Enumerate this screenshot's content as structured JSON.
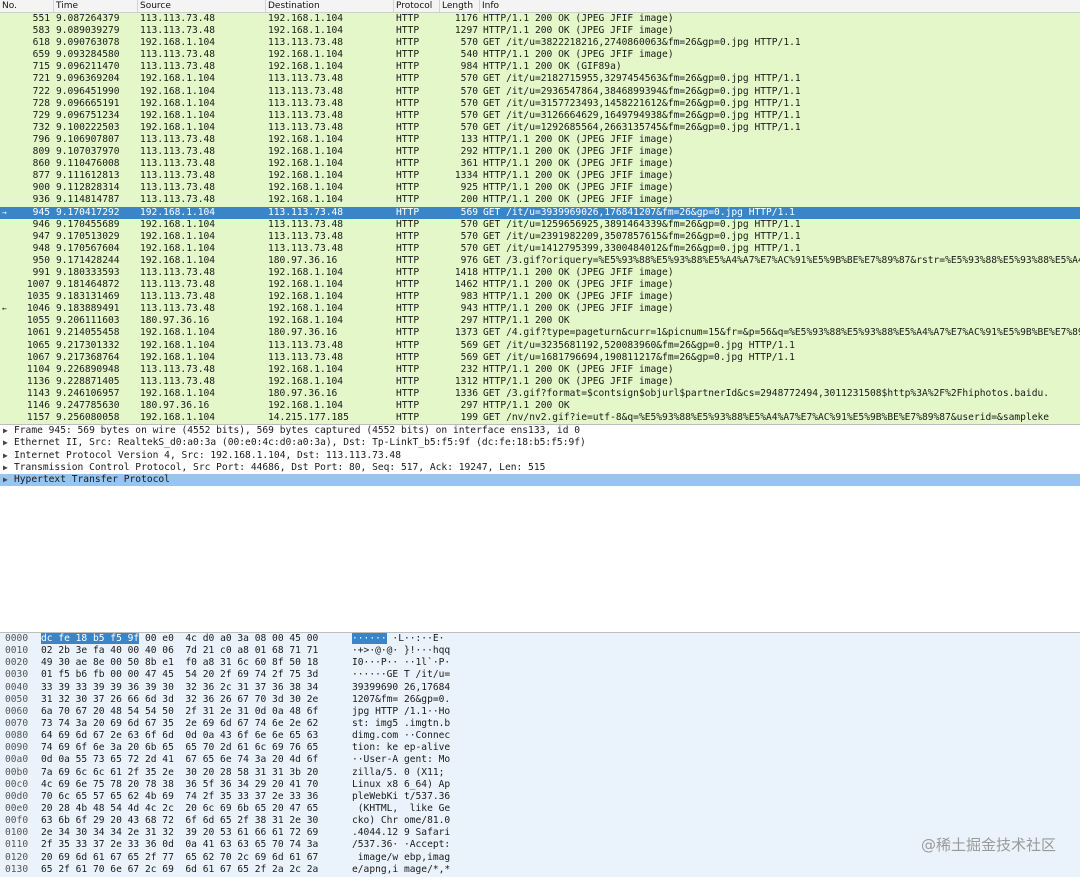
{
  "packet_list": {
    "columns": [
      "No.",
      "Time",
      "Source",
      "Destination",
      "Protocol",
      "Length",
      "Info"
    ],
    "rows": [
      {
        "no": "551",
        "time": "9.087264379",
        "src": "113.113.73.48",
        "dst": "192.168.1.104",
        "proto": "HTTP",
        "len": "1176",
        "info": "HTTP/1.1 200 OK  (JPEG JFIF image)"
      },
      {
        "no": "583",
        "time": "9.089039279",
        "src": "113.113.73.48",
        "dst": "192.168.1.104",
        "proto": "HTTP",
        "len": "1297",
        "info": "HTTP/1.1 200 OK  (JPEG JFIF image)"
      },
      {
        "no": "618",
        "time": "9.090763078",
        "src": "192.168.1.104",
        "dst": "113.113.73.48",
        "proto": "HTTP",
        "len": "570",
        "info": "GET /it/u=3822218216,2740860063&fm=26&gp=0.jpg HTTP/1.1"
      },
      {
        "no": "659",
        "time": "9.093284580",
        "src": "113.113.73.48",
        "dst": "192.168.1.104",
        "proto": "HTTP",
        "len": "540",
        "info": "HTTP/1.1 200 OK  (JPEG JFIF image)"
      },
      {
        "no": "715",
        "time": "9.096211470",
        "src": "113.113.73.48",
        "dst": "192.168.1.104",
        "proto": "HTTP",
        "len": "984",
        "info": "HTTP/1.1 200 OK  (GIF89a)"
      },
      {
        "no": "721",
        "time": "9.096369204",
        "src": "192.168.1.104",
        "dst": "113.113.73.48",
        "proto": "HTTP",
        "len": "570",
        "info": "GET /it/u=2182715955,3297454563&fm=26&gp=0.jpg HTTP/1.1"
      },
      {
        "no": "722",
        "time": "9.096451990",
        "src": "192.168.1.104",
        "dst": "113.113.73.48",
        "proto": "HTTP",
        "len": "570",
        "info": "GET /it/u=2936547864,3846899394&fm=26&gp=0.jpg HTTP/1.1"
      },
      {
        "no": "728",
        "time": "9.096665191",
        "src": "192.168.1.104",
        "dst": "113.113.73.48",
        "proto": "HTTP",
        "len": "570",
        "info": "GET /it/u=3157723493,1458221612&fm=26&gp=0.jpg HTTP/1.1"
      },
      {
        "no": "729",
        "time": "9.096751234",
        "src": "192.168.1.104",
        "dst": "113.113.73.48",
        "proto": "HTTP",
        "len": "570",
        "info": "GET /it/u=3126664629,1649794938&fm=26&gp=0.jpg HTTP/1.1"
      },
      {
        "no": "732",
        "time": "9.100222503",
        "src": "192.168.1.104",
        "dst": "113.113.73.48",
        "proto": "HTTP",
        "len": "570",
        "info": "GET /it/u=1292685564,2663135745&fm=26&gp=0.jpg HTTP/1.1"
      },
      {
        "no": "796",
        "time": "9.106907807",
        "src": "113.113.73.48",
        "dst": "192.168.1.104",
        "proto": "HTTP",
        "len": "133",
        "info": "HTTP/1.1 200 OK  (JPEG JFIF image)"
      },
      {
        "no": "809",
        "time": "9.107037970",
        "src": "113.113.73.48",
        "dst": "192.168.1.104",
        "proto": "HTTP",
        "len": "292",
        "info": "HTTP/1.1 200 OK  (JPEG JFIF image)"
      },
      {
        "no": "860",
        "time": "9.110476008",
        "src": "113.113.73.48",
        "dst": "192.168.1.104",
        "proto": "HTTP",
        "len": "361",
        "info": "HTTP/1.1 200 OK  (JPEG JFIF image)"
      },
      {
        "no": "877",
        "time": "9.111612813",
        "src": "113.113.73.48",
        "dst": "192.168.1.104",
        "proto": "HTTP",
        "len": "1334",
        "info": "HTTP/1.1 200 OK  (JPEG JFIF image)"
      },
      {
        "no": "900",
        "time": "9.112828314",
        "src": "113.113.73.48",
        "dst": "192.168.1.104",
        "proto": "HTTP",
        "len": "925",
        "info": "HTTP/1.1 200 OK  (JPEG JFIF image)"
      },
      {
        "no": "936",
        "time": "9.114814787",
        "src": "113.113.73.48",
        "dst": "192.168.1.104",
        "proto": "HTTP",
        "len": "200",
        "info": "HTTP/1.1 200 OK  (JPEG JFIF image)"
      },
      {
        "no": "945",
        "time": "9.170417292",
        "src": "192.168.1.104",
        "dst": "113.113.73.48",
        "proto": "HTTP",
        "len": "569",
        "info": "GET /it/u=3939969026,176841207&fm=26&gp=0.jpg HTTP/1.1",
        "selected": true,
        "marker": "→"
      },
      {
        "no": "946",
        "time": "9.170455689",
        "src": "192.168.1.104",
        "dst": "113.113.73.48",
        "proto": "HTTP",
        "len": "570",
        "info": "GET /it/u=1259656925,3891464339&fm=26&gp=0.jpg HTTP/1.1"
      },
      {
        "no": "947",
        "time": "9.170513029",
        "src": "192.168.1.104",
        "dst": "113.113.73.48",
        "proto": "HTTP",
        "len": "570",
        "info": "GET /it/u=2391982209,3507857615&fm=26&gp=0.jpg HTTP/1.1"
      },
      {
        "no": "948",
        "time": "9.170567604",
        "src": "192.168.1.104",
        "dst": "113.113.73.48",
        "proto": "HTTP",
        "len": "570",
        "info": "GET /it/u=1412795399,3300484012&fm=26&gp=0.jpg HTTP/1.1"
      },
      {
        "no": "950",
        "time": "9.171428244",
        "src": "192.168.1.104",
        "dst": "180.97.36.16",
        "proto": "HTTP",
        "len": "976",
        "info": "GET /3.gif?oriquery=%E5%93%88%E5%93%88%E5%A4%A7%E7%AC%91%E5%9B%BE%E7%89%87&rstr=%E5%93%88%E5%93%88%E5%A4%A7"
      },
      {
        "no": "991",
        "time": "9.180333593",
        "src": "113.113.73.48",
        "dst": "192.168.1.104",
        "proto": "HTTP",
        "len": "1418",
        "info": "HTTP/1.1 200 OK  (JPEG JFIF image)"
      },
      {
        "no": "1007",
        "time": "9.181464872",
        "src": "113.113.73.48",
        "dst": "192.168.1.104",
        "proto": "HTTP",
        "len": "1462",
        "info": "HTTP/1.1 200 OK  (JPEG JFIF image)"
      },
      {
        "no": "1035",
        "time": "9.183131469",
        "src": "113.113.73.48",
        "dst": "192.168.1.104",
        "proto": "HTTP",
        "len": "983",
        "info": "HTTP/1.1 200 OK  (JPEG JFIF image)"
      },
      {
        "no": "1046",
        "time": "9.183889491",
        "src": "113.113.73.48",
        "dst": "192.168.1.104",
        "proto": "HTTP",
        "len": "943",
        "info": "HTTP/1.1 200 OK  (JPEG JFIF image)",
        "marker": "←"
      },
      {
        "no": "1055",
        "time": "9.206111603",
        "src": "180.97.36.16",
        "dst": "192.168.1.104",
        "proto": "HTTP",
        "len": "297",
        "info": "HTTP/1.1 200 OK"
      },
      {
        "no": "1061",
        "time": "9.214055458",
        "src": "192.168.1.104",
        "dst": "180.97.36.16",
        "proto": "HTTP",
        "len": "1373",
        "info": "GET /4.gif?type=pageturn&curr=1&picnum=15&fr=&p=56&q=%E5%93%88%E5%93%88%E5%A4%A7%E7%AC%91%E5%9B%BE%E7%89%87"
      },
      {
        "no": "1065",
        "time": "9.217301332",
        "src": "192.168.1.104",
        "dst": "113.113.73.48",
        "proto": "HTTP",
        "len": "569",
        "info": "GET /it/u=3235681192,520083960&fm=26&gp=0.jpg HTTP/1.1"
      },
      {
        "no": "1067",
        "time": "9.217368764",
        "src": "192.168.1.104",
        "dst": "113.113.73.48",
        "proto": "HTTP",
        "len": "569",
        "info": "GET /it/u=1681796694,190811217&fm=26&gp=0.jpg HTTP/1.1"
      },
      {
        "no": "1104",
        "time": "9.226890948",
        "src": "113.113.73.48",
        "dst": "192.168.1.104",
        "proto": "HTTP",
        "len": "232",
        "info": "HTTP/1.1 200 OK  (JPEG JFIF image)"
      },
      {
        "no": "1136",
        "time": "9.228871405",
        "src": "113.113.73.48",
        "dst": "192.168.1.104",
        "proto": "HTTP",
        "len": "1312",
        "info": "HTTP/1.1 200 OK  (JPEG JFIF image)"
      },
      {
        "no": "1143",
        "time": "9.246106957",
        "src": "192.168.1.104",
        "dst": "180.97.36.16",
        "proto": "HTTP",
        "len": "1336",
        "info": "GET /3.gif?format=$contsign$objurl$partnerId&cs=2948772494,3011231508$http%3A%2F%2Fhiphotos.baidu."
      },
      {
        "no": "1146",
        "time": "9.247785630",
        "src": "180.97.36.16",
        "dst": "192.168.1.104",
        "proto": "HTTP",
        "len": "297",
        "info": "HTTP/1.1 200 OK"
      },
      {
        "no": "1157",
        "time": "9.256080058",
        "src": "192.168.1.104",
        "dst": "14.215.177.185",
        "proto": "HTTP",
        "len": "199",
        "info": "GET /nv/nv2.gif?ie=utf-8&q=%E5%93%88%E5%93%88%E5%A4%A7%E7%AC%91%E5%9B%BE%E7%89%87&userid=&sampleke"
      }
    ]
  },
  "details": [
    {
      "text": "Frame 945: 569 bytes on wire (4552 bits), 569 bytes captured (4552 bits) on interface ens133, id 0"
    },
    {
      "text": "Ethernet II, Src: RealtekS_d0:a0:3a (00:e0:4c:d0:a0:3a), Dst: Tp-LinkT_b5:f5:9f (dc:fe:18:b5:f5:9f)"
    },
    {
      "text": "Internet Protocol Version 4, Src: 192.168.1.104, Dst: 113.113.73.48"
    },
    {
      "text": "Transmission Control Protocol, Src Port: 44686, Dst Port: 80, Seq: 517, Ack: 19247, Len: 515"
    },
    {
      "text": "Hypertext Transfer Protocol",
      "selected": true
    }
  ],
  "bytes": [
    {
      "off": "0000",
      "hl": "dc fe 18 b5 f5 9f",
      "hex": " 00 e0  4c d0 a0 3a 08 00 45 00",
      "ahl": "······",
      "asc": " ·L··:··E·"
    },
    {
      "off": "0010",
      "hex": "02 2b 3e fa 40 00 40 06  7d 21 c0 a8 01 68 71 71",
      "asc": "·+>·@·@· }!···hqq"
    },
    {
      "off": "0020",
      "hex": "49 30 ae 8e 00 50 8b e1  f0 a8 31 6c 60 8f 50 18",
      "asc": "I0···P·· ··1l`·P·"
    },
    {
      "off": "0030",
      "hex": "01 f5 b6 fb 00 00 47 45  54 20 2f 69 74 2f 75 3d",
      "asc": "······GE T /it/u="
    },
    {
      "off": "0040",
      "hex": "33 39 33 39 39 36 39 30  32 36 2c 31 37 36 38 34",
      "asc": "39399690 26,17684"
    },
    {
      "off": "0050",
      "hex": "31 32 30 37 26 66 6d 3d  32 36 26 67 70 3d 30 2e",
      "asc": "1207&fm= 26&gp=0."
    },
    {
      "off": "0060",
      "hex": "6a 70 67 20 48 54 54 50  2f 31 2e 31 0d 0a 48 6f",
      "asc": "jpg HTTP /1.1··Ho"
    },
    {
      "off": "0070",
      "hex": "73 74 3a 20 69 6d 67 35  2e 69 6d 67 74 6e 2e 62",
      "asc": "st: img5 .imgtn.b"
    },
    {
      "off": "0080",
      "hex": "64 69 6d 67 2e 63 6f 6d  0d 0a 43 6f 6e 6e 65 63",
      "asc": "dimg.com ··Connec"
    },
    {
      "off": "0090",
      "hex": "74 69 6f 6e 3a 20 6b 65  65 70 2d 61 6c 69 76 65",
      "asc": "tion: ke ep-alive"
    },
    {
      "off": "00a0",
      "hex": "0d 0a 55 73 65 72 2d 41  67 65 6e 74 3a 20 4d 6f",
      "asc": "··User-A gent: Mo"
    },
    {
      "off": "00b0",
      "hex": "7a 69 6c 6c 61 2f 35 2e  30 20 28 58 31 31 3b 20",
      "asc": "zilla/5. 0 (X11; "
    },
    {
      "off": "00c0",
      "hex": "4c 69 6e 75 78 20 78 38  36 5f 36 34 29 20 41 70",
      "asc": "Linux x8 6_64) Ap"
    },
    {
      "off": "00d0",
      "hex": "70 6c 65 57 65 62 4b 69  74 2f 35 33 37 2e 33 36",
      "asc": "pleWebKi t/537.36"
    },
    {
      "off": "00e0",
      "hex": "20 28 4b 48 54 4d 4c 2c  20 6c 69 6b 65 20 47 65",
      "asc": " (KHTML,  like Ge"
    },
    {
      "off": "00f0",
      "hex": "63 6b 6f 29 20 43 68 72  6f 6d 65 2f 38 31 2e 30",
      "asc": "cko) Chr ome/81.0"
    },
    {
      "off": "0100",
      "hex": "2e 34 30 34 34 2e 31 32  39 20 53 61 66 61 72 69",
      "asc": ".4044.12 9 Safari"
    },
    {
      "off": "0110",
      "hex": "2f 35 33 37 2e 33 36 0d  0a 41 63 63 65 70 74 3a",
      "asc": "/537.36· ·Accept:"
    },
    {
      "off": "0120",
      "hex": "20 69 6d 61 67 65 2f 77  65 62 70 2c 69 6d 61 67",
      "asc": " image/w ebp,imag"
    },
    {
      "off": "0130",
      "hex": "65 2f 61 70 6e 67 2c 69  6d 61 67 65 2f 2a 2c 2a",
      "asc": "e/apng,i mage/*,*"
    }
  ],
  "watermark": "@稀土掘金技术社区"
}
